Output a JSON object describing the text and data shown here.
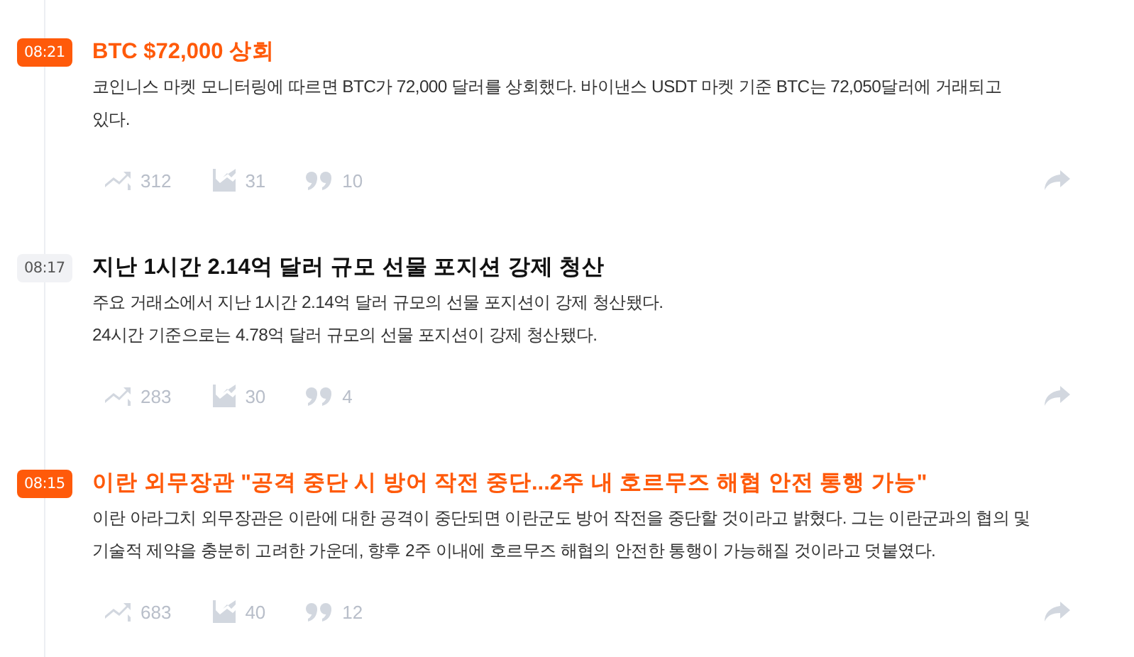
{
  "items": [
    {
      "time": "08:21",
      "important": true,
      "title": "BTC $72,000 상회",
      "lines": [
        "코인니스 마켓 모니터링에 따르면 BTC가 72,000 달러를 상회했다. 바이낸스 USDT 마켓 기준 BTC는 72,050달러에 거래되고",
        "있다."
      ],
      "bullish": "312",
      "bearish": "31",
      "comments": "10"
    },
    {
      "time": "08:17",
      "important": false,
      "title": "지난 1시간 2.14억 달러 규모 선물 포지션 강제 청산",
      "lines": [
        "주요 거래소에서 지난 1시간 2.14억 달러 규모의 선물 포지션이 강제 청산됐다.",
        "24시간 기준으로는 4.78억 달러 규모의 선물 포지션이 강제 청산됐다."
      ],
      "bullish": "283",
      "bearish": "30",
      "comments": "4"
    },
    {
      "time": "08:15",
      "important": true,
      "title": "이란 외무장관 \"공격 중단 시 방어 작전 중단...2주 내 호르무즈 해협 안전 통행 가능\"",
      "lines": [
        "이란 아라그치 외무장관은 이란에 대한 공격이 중단되면 이란군도 방어 작전을 중단할 것이라고 밝혔다. 그는 이란군과의 협의 및",
        "기술적 제약을 충분히 고려한 가운데, 향후 2주 이내에 호르무즈 해협의 안전한 통행이 가능해질 것이라고 덧붙였다."
      ],
      "bullish": "683",
      "bearish": "40",
      "comments": "12"
    }
  ]
}
